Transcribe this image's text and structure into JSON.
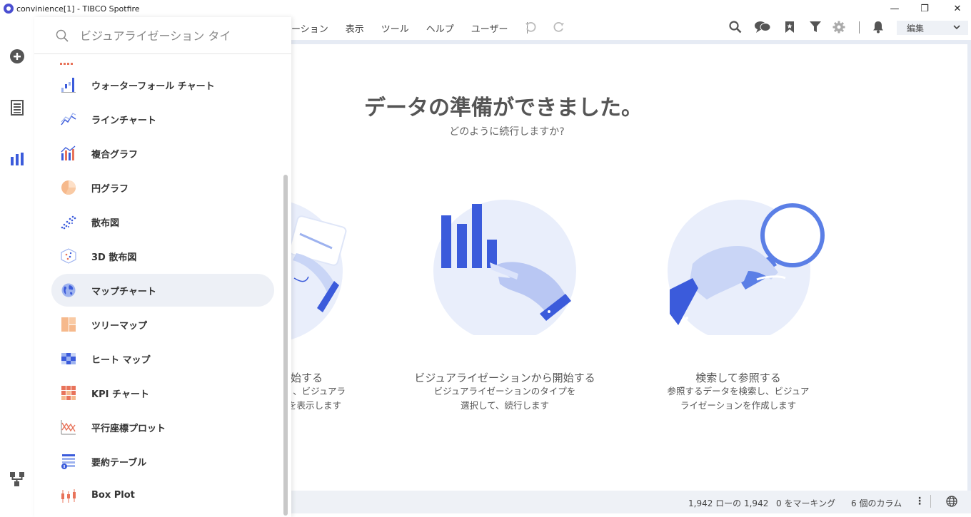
{
  "window": {
    "title": "convinience[1] - TIBCO Spotfire",
    "controls": {
      "minimize": "—",
      "maximize": "❐",
      "close": "✕"
    }
  },
  "rail": {
    "icons": [
      "add-icon",
      "data-table-icon",
      "visualization-icon",
      "data-canvas-icon"
    ]
  },
  "menubar": {
    "items": [
      "ーション",
      "表示",
      "ツール",
      "ヘルプ",
      "ユーザー"
    ],
    "edit_label": "編集"
  },
  "toolbar": {
    "icons": [
      "undo-icon",
      "redo-icon",
      "search-icon",
      "collaboration-icon",
      "bookmark-icon",
      "filter-icon",
      "settings-icon",
      "notification-icon"
    ]
  },
  "welcome": {
    "title": "データの準備ができました。",
    "subtitle": "どのように続行しますか?",
    "options": [
      {
        "title": "始する",
        "desc_line1": "、ビジュアラ",
        "desc_line2": "を表示します"
      },
      {
        "title": "ビジュアライゼーションから開始する",
        "desc_line1": "ビジュアライゼーションのタイプを",
        "desc_line2": "選択して、続行します"
      },
      {
        "title": "検索して参照する",
        "desc_line1": "参照するデータを検索し、ビジュア",
        "desc_line2": "ライゼーションを作成します"
      }
    ]
  },
  "statusbar": {
    "rows": "1,942 ローの 1,942",
    "marking": "0 をマーキング",
    "columns": "6 個のカラム",
    "more": "⋮"
  },
  "flyout": {
    "search_placeholder": "ビジュアライゼーション タイ",
    "items": [
      {
        "label": "ウォーターフォール チャート",
        "icon": "waterfall-chart-icon"
      },
      {
        "label": "ラインチャート",
        "icon": "line-chart-icon"
      },
      {
        "label": "複合グラフ",
        "icon": "combination-chart-icon"
      },
      {
        "label": "円グラフ",
        "icon": "pie-chart-icon"
      },
      {
        "label": "散布図",
        "icon": "scatter-plot-icon"
      },
      {
        "label": "3D 散布図",
        "icon": "3d-scatter-plot-icon"
      },
      {
        "label": "マップチャート",
        "icon": "map-chart-icon",
        "active": true
      },
      {
        "label": "ツリーマップ",
        "icon": "treemap-icon"
      },
      {
        "label": "ヒート マップ",
        "icon": "heat-map-icon"
      },
      {
        "label": "KPI チャート",
        "icon": "kpi-chart-icon"
      },
      {
        "label": "平行座標プロット",
        "icon": "parallel-coordinate-plot-icon"
      },
      {
        "label": "要約テーブル",
        "icon": "summary-table-icon"
      },
      {
        "label": "Box Plot",
        "icon": "box-plot-icon"
      }
    ]
  },
  "colors": {
    "accent": "#3b5bdb",
    "illustration_light": "#e9eefb",
    "illustration_blue": "#4a6fe0",
    "selected_bg": "#edf0f6"
  }
}
